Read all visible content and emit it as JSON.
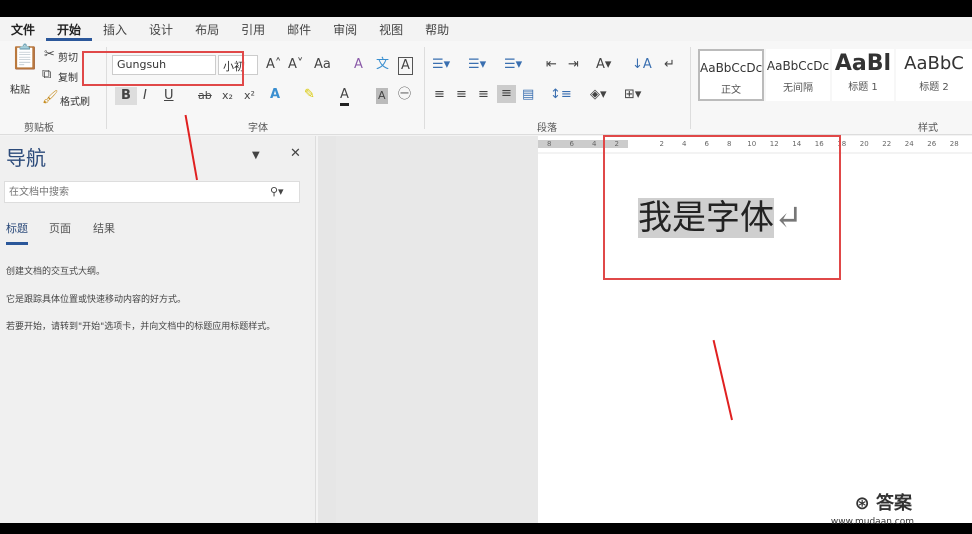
{
  "tabs": [
    "文件",
    "开始",
    "插入",
    "设计",
    "布局",
    "引用",
    "邮件",
    "审阅",
    "视图",
    "帮助"
  ],
  "clipboard": {
    "paste": "粘贴",
    "cut": "剪切",
    "copy": "复制",
    "format_painter": "格式刷",
    "label": "剪贴板"
  },
  "font": {
    "name": "Gungsuh",
    "size": "小初",
    "label": "字体",
    "buttons": [
      "B",
      "I",
      "U",
      "ab",
      "x₂",
      "x²"
    ]
  },
  "paragraph": {
    "label": "段落"
  },
  "styles": {
    "label": "样式",
    "items": [
      {
        "preview": "AaBbCcDc",
        "name": "正文"
      },
      {
        "preview": "AaBbCcDc",
        "name": "无间隔"
      },
      {
        "preview": "AaBl",
        "name": "标题 1"
      },
      {
        "preview": "AaBbC",
        "name": "标题 2"
      }
    ]
  },
  "nav": {
    "title": "导航",
    "search_placeholder": "在文档中搜索",
    "tabs": [
      "标题",
      "页面",
      "结果"
    ],
    "lines": [
      "创建文档的交互式大纲。",
      "它是跟踪具体位置或快速移动内容的好方式。",
      "若要开始，请转到\"开始\"选项卡，并向文档中的标题应用标题样式。"
    ]
  },
  "ruler": [
    "8",
    "6",
    "4",
    "2",
    "",
    "2",
    "4",
    "6",
    "8",
    "10",
    "12",
    "14",
    "16",
    "18",
    "20",
    "22",
    "24",
    "26",
    "28"
  ],
  "document": {
    "text": "我是字体",
    "mark": "↵"
  },
  "watermark": {
    "brand": "答案",
    "url": "www.mudaan.com"
  },
  "colors": {
    "highlight_box": "#e04848",
    "accent": "#2b579a"
  }
}
